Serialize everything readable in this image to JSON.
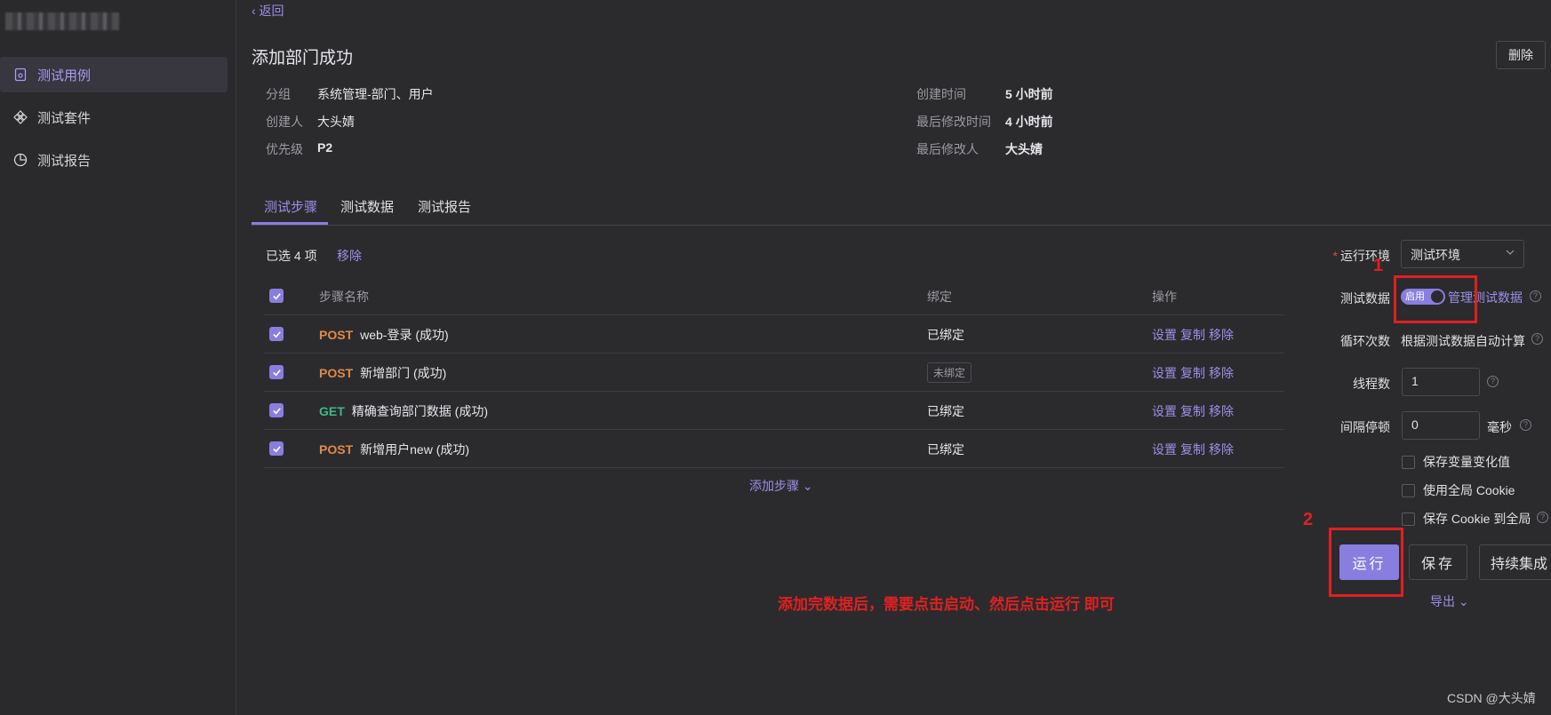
{
  "sidebar": {
    "items": [
      {
        "label": "测试用例",
        "icon": "file-code-icon",
        "active": true
      },
      {
        "label": "测试套件",
        "icon": "diamond-grid-icon",
        "active": false
      },
      {
        "label": "测试报告",
        "icon": "pie-chart-icon",
        "active": false
      }
    ]
  },
  "header": {
    "back_label": "‹ 返回",
    "title": "添加部门成功",
    "delete_label": "删除"
  },
  "meta": {
    "group_label": "分组",
    "group_value": "系统管理-部门、用户",
    "creator_label": "创建人",
    "creator_value": "大头婧",
    "priority_label": "优先级",
    "priority_value": "P2",
    "created_label": "创建时间",
    "created_value": "5 小时前",
    "modified_label": "最后修改时间",
    "modified_value": "4 小时前",
    "modifier_label": "最后修改人",
    "modifier_value": "大头婧"
  },
  "tabs": [
    "测试步骤",
    "测试数据",
    "测试报告"
  ],
  "selection": {
    "count_label": "已选 4 项",
    "remove_label": "移除"
  },
  "table": {
    "headers": {
      "name": "步骤名称",
      "bind": "绑定",
      "op": "操作"
    },
    "rows": [
      {
        "method": "POST",
        "name": "web-登录 (成功)",
        "bind": "已绑定",
        "unbound": false
      },
      {
        "method": "POST",
        "name": "新增部门 (成功)",
        "bind": "未绑定",
        "unbound": true
      },
      {
        "method": "GET",
        "name": "精确查询部门数据 (成功)",
        "bind": "已绑定",
        "unbound": false
      },
      {
        "method": "POST",
        "name": "新增用户new (成功)",
        "bind": "已绑定",
        "unbound": false
      }
    ],
    "ops": {
      "settings": "设置",
      "copy": "复制",
      "remove": "移除"
    }
  },
  "add_step_label": "添加步骤 ⌄",
  "panel": {
    "env_label": "运行环境",
    "env_value": "测试环境",
    "data_label": "测试数据",
    "toggle_label": "启用",
    "manage_label": "管理测试数据",
    "loop_label": "循环次数",
    "loop_value": "根据测试数据自动计算",
    "threads_label": "线程数",
    "threads_value": "1",
    "interval_label": "间隔停顿",
    "interval_value": "0",
    "interval_unit": "毫秒",
    "checks": [
      "保存变量变化值",
      "使用全局 Cookie",
      "保存 Cookie 到全局"
    ],
    "run_label": "运行",
    "save_label": "保存",
    "ci_label": "持续集成",
    "export_label": "导出 ⌄"
  },
  "annotations": {
    "num1": "1",
    "num2": "2",
    "note": "添加完数据后，需要点击启动、然后点击运行 即可",
    "color": "#e02020"
  },
  "watermark": "CSDN @大头婧",
  "colors": {
    "accent": "#8a7de0",
    "post": "#e08a45",
    "get": "#3db88a"
  }
}
